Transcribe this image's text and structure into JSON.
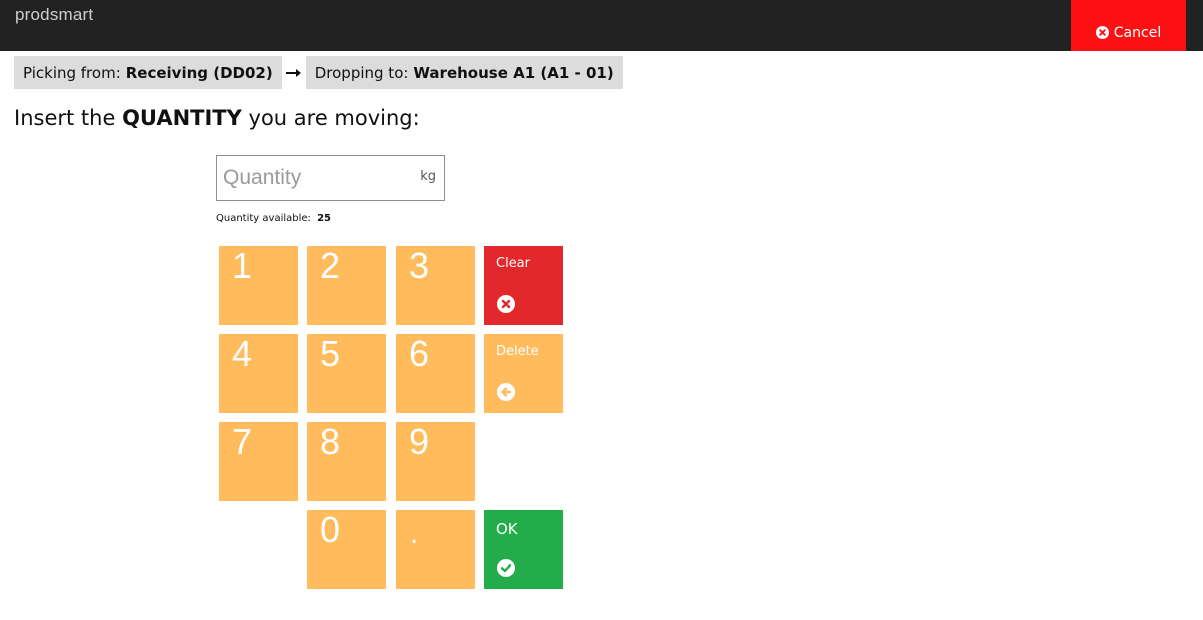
{
  "app": {
    "brand": "prodsmart",
    "cancel_label": "Cancel"
  },
  "route": {
    "from_label": "Picking from:",
    "from_value": "Receiving (DD02)",
    "to_label": "Dropping to:",
    "to_value": "Warehouse A1 (A1 - 01)"
  },
  "prompt": {
    "before": "Insert the",
    "emphasis": "QUANTITY",
    "after": "you are moving:"
  },
  "quantity": {
    "placeholder": "Quantity",
    "value": "",
    "unit": "kg",
    "available_label": "Quantity available:",
    "available_value": "25"
  },
  "keypad": {
    "digits": [
      "1",
      "2",
      "3",
      "4",
      "5",
      "6",
      "7",
      "8",
      "9",
      "0",
      "."
    ],
    "clear_label": "Clear",
    "delete_label": "Delete",
    "ok_label": "OK"
  },
  "colors": {
    "topbar": "#222222",
    "cancel": "#fe1114",
    "key": "#ffbb5c",
    "clear": "#e2282d",
    "ok": "#22ac4a",
    "chip": "#dcdcdc"
  }
}
